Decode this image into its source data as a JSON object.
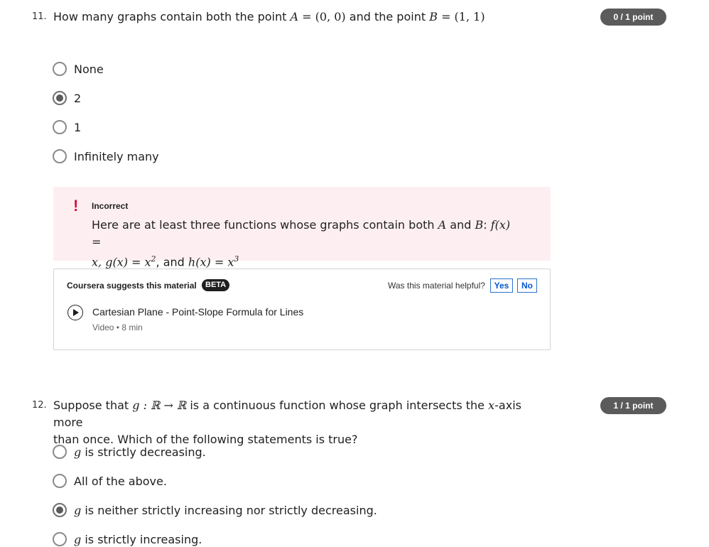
{
  "q11": {
    "number": "11.",
    "text_pre": "How many graphs contain both the point",
    "A_label": "A",
    "A_value": "= (0, 0)",
    "text_mid": "and the point",
    "B_label": "B",
    "B_value": "= (1, 1)",
    "points": "0 / 1 point",
    "options": [
      {
        "label": "None",
        "selected": false
      },
      {
        "label": "2",
        "selected": true
      },
      {
        "label": "1",
        "selected": false
      },
      {
        "label": "Infinitely many",
        "selected": false
      }
    ],
    "feedback": {
      "icon": "!",
      "title": "Incorrect",
      "body_1": "Here are at least three functions whose graphs contain both",
      "A": "A",
      "and_1": "and",
      "B": "B",
      "f": "f(x) =",
      "line2_a": "x, g(x) = x",
      "sq": "2",
      "comma_and": ", and",
      "h": "h(x) = x",
      "cube": "3"
    },
    "suggest": {
      "heading": "Coursera suggests this material",
      "badge": "BETA",
      "helpful": "Was this material helpful?",
      "yes": "Yes",
      "no": "No",
      "item_title": "Cartesian Plane - Point-Slope Formula for Lines",
      "item_meta": "Video • 8 min",
      "item_icon": "play-icon"
    }
  },
  "q12": {
    "number": "12.",
    "text_1": "Suppose that",
    "g_map": "g : ℝ → ℝ",
    "text_2": "is a continuous function whose graph intersects the",
    "x_var": "x",
    "text_3": "-axis more",
    "text_line2": "than once. Which of the following statements is true?",
    "points": "1 / 1 point",
    "options": [
      {
        "g": "g",
        "label": "is strictly decreasing.",
        "selected": false
      },
      {
        "g": "",
        "label": "All of the above.",
        "selected": false
      },
      {
        "g": "g",
        "label": "is neither strictly increasing nor strictly decreasing.",
        "selected": true
      },
      {
        "g": "g",
        "label": "is strictly increasing.",
        "selected": false
      }
    ]
  },
  "colors": {
    "accent": "#0056d2",
    "error": "#d3123c",
    "feedback_bg": "#fdeff1",
    "badge": "#5b5b5b"
  }
}
